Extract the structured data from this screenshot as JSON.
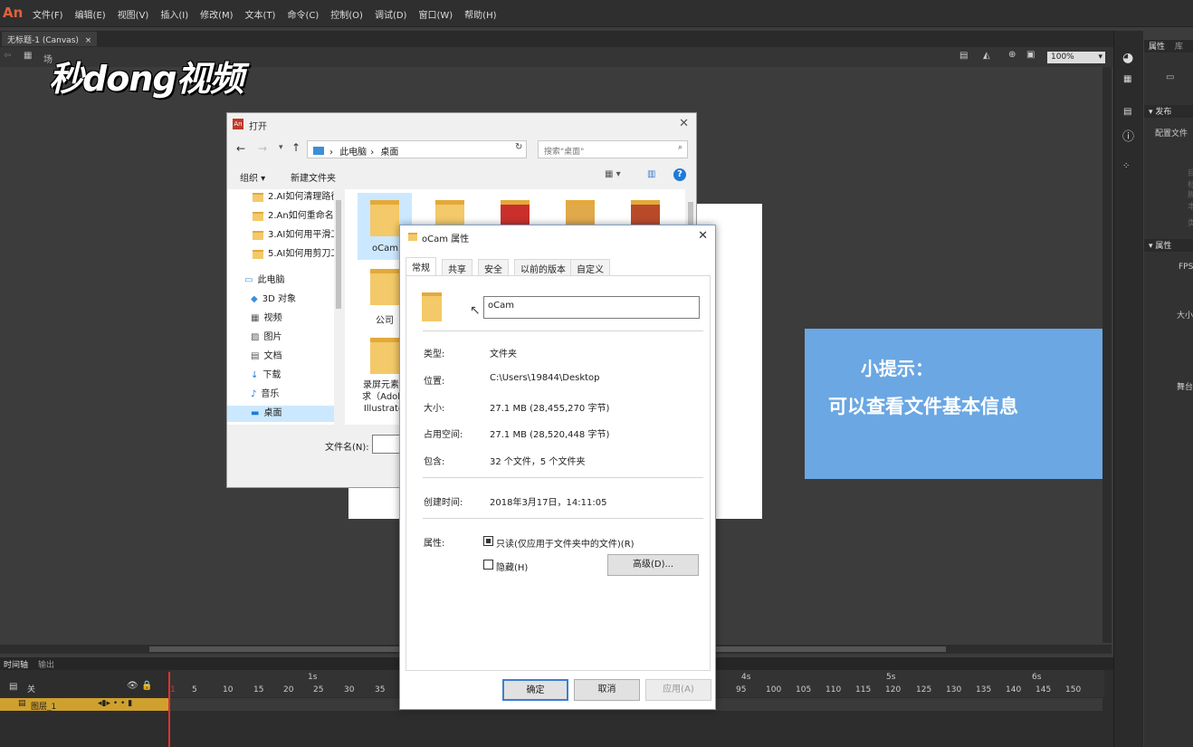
{
  "app": {
    "logo": "An",
    "menu": [
      "文件(F)",
      "编辑(E)",
      "视图(V)",
      "插入(I)",
      "修改(M)",
      "文本(T)",
      "命令(C)",
      "控制(O)",
      "调试(D)",
      "窗口(W)",
      "帮助(H)"
    ],
    "doc_tab": "无标题-1 (Canvas)",
    "doc_tab_close": "×",
    "scene": "场",
    "zoom": "100%",
    "brand": "秒dong视频"
  },
  "right_panel": {
    "tabs": [
      "属性",
      "库"
    ],
    "publish_header": "发布",
    "profile_label": "配置文件",
    "target_label": "目标",
    "script_label": "脚本",
    "class_label": "类",
    "properties_header": "属性",
    "fps_label": "FPS",
    "size_label": "大小",
    "stage_label": "舞台"
  },
  "hint": {
    "title": "小提示：",
    "text": "可以查看文件基本信息"
  },
  "timeline": {
    "tabs": [
      "时间轴",
      "输出"
    ],
    "layer_header": "关",
    "layer_name": "图层_1",
    "seconds": [
      "1s",
      "4s",
      "5s",
      "6s"
    ],
    "frames_left": [
      "1",
      "5",
      "10",
      "15",
      "20",
      "25",
      "30",
      "35"
    ],
    "frames_right": [
      "95",
      "100",
      "105",
      "110",
      "115",
      "120",
      "125",
      "130",
      "135",
      "140",
      "145",
      "150"
    ]
  },
  "open_dialog": {
    "title": "打开",
    "breadcrumb": [
      "此电脑",
      "桌面"
    ],
    "search_placeholder": "搜索\"桌面\"",
    "organize": "组织 ▾",
    "new_folder": "新建文件夹",
    "nav_folders": [
      "2.AI如何清理路径",
      "2.An如何重命名",
      "3.AI如何用平滑工",
      "5.AI如何用剪刀工"
    ],
    "nav_places": [
      "此电脑",
      "3D 对象",
      "视频",
      "图片",
      "文档",
      "下载",
      "音乐",
      "桌面"
    ],
    "files": [
      "oCam",
      "公司",
      "录屏元素要求（Adobe Illustrator"
    ],
    "filename_label": "文件名(N):"
  },
  "props_dialog": {
    "title": "oCam 属性",
    "tabs": [
      "常规",
      "共享",
      "安全",
      "以前的版本",
      "自定义"
    ],
    "name_value": "oCam",
    "rows": [
      {
        "label": "类型:",
        "value": "文件夹"
      },
      {
        "label": "位置:",
        "value": "C:\\Users\\19844\\Desktop"
      },
      {
        "label": "大小:",
        "value": "27.1 MB (28,455,270 字节)"
      },
      {
        "label": "占用空间:",
        "value": "27.1 MB (28,520,448 字节)"
      },
      {
        "label": "包含:",
        "value": "32 个文件，5 个文件夹"
      }
    ],
    "created_label": "创建时间:",
    "created_value": "2018年3月17日，14:11:05",
    "attr_label": "属性:",
    "readonly_label": "只读(仅应用于文件夹中的文件)(R)",
    "hidden_label": "隐藏(H)",
    "advanced_button": "高级(D)...",
    "ok_button": "确定",
    "cancel_button": "取消",
    "apply_button": "应用(A)"
  },
  "colors": {
    "hint_bg": "#6aa7e3",
    "layer_bar": "#cfa02e",
    "playhead": "#e03030",
    "dialog_accent": "#3c7fd1"
  }
}
